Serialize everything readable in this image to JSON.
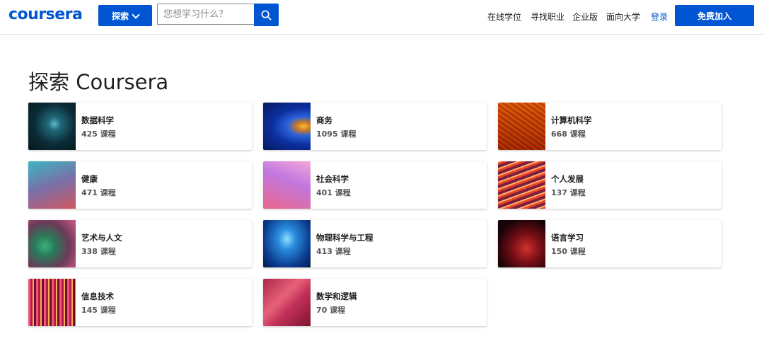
{
  "header": {
    "logo_text": "coursera",
    "explore_label": "探索",
    "search_placeholder": "您想学习什么？",
    "nav": [
      "在线学位",
      "寻找职业",
      "企业版",
      "面向大学"
    ],
    "login_label": "登录",
    "join_label": "免费加入"
  },
  "main": {
    "title": "探索 Coursera",
    "categories": [
      {
        "name": "数据科学",
        "count": "425 课程"
      },
      {
        "name": "商务",
        "count": "1095 课程"
      },
      {
        "name": "计算机科学",
        "count": "668 课程"
      },
      {
        "name": "健康",
        "count": "471 课程"
      },
      {
        "name": "社会科学",
        "count": "401 课程"
      },
      {
        "name": "个人发展",
        "count": "137 课程"
      },
      {
        "name": "艺术与人文",
        "count": "338 课程"
      },
      {
        "name": "物理科学与工程",
        "count": "413 课程"
      },
      {
        "name": "语言学习",
        "count": "150 课程"
      },
      {
        "name": "信息技术",
        "count": "145 课程"
      },
      {
        "name": "数学和逻辑",
        "count": "70 课程"
      }
    ]
  },
  "colors": {
    "brand": "#0056d2",
    "text": "#1f1f1f"
  }
}
